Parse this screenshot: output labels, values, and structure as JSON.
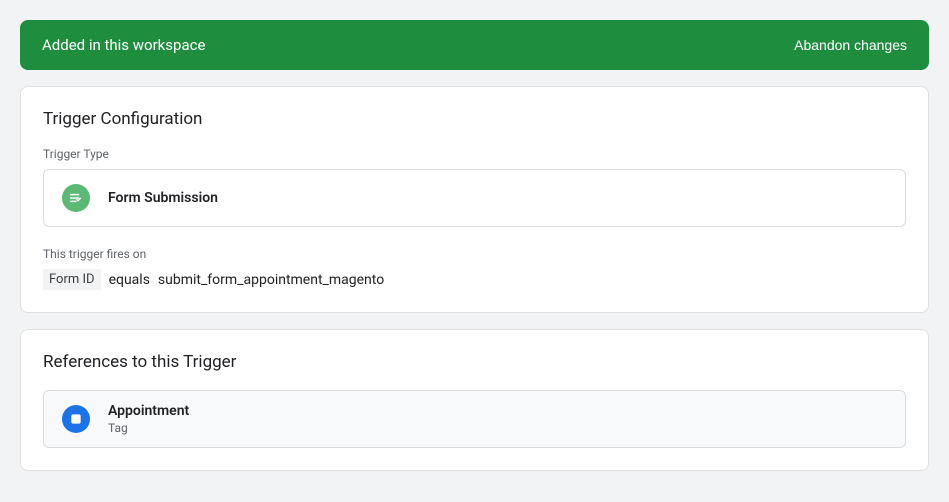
{
  "banner": {
    "title": "Added in this workspace",
    "action": "Abandon changes"
  },
  "config": {
    "title": "Trigger Configuration",
    "type_label": "Trigger Type",
    "type_value": "Form Submission",
    "fires_label": "This trigger fires on",
    "condition": {
      "key": "Form ID",
      "operator": "equals",
      "value": "submit_form_appointment_magento"
    }
  },
  "refs": {
    "title": "References to this Trigger",
    "items": [
      {
        "name": "Appointment",
        "type": "Tag"
      }
    ]
  }
}
